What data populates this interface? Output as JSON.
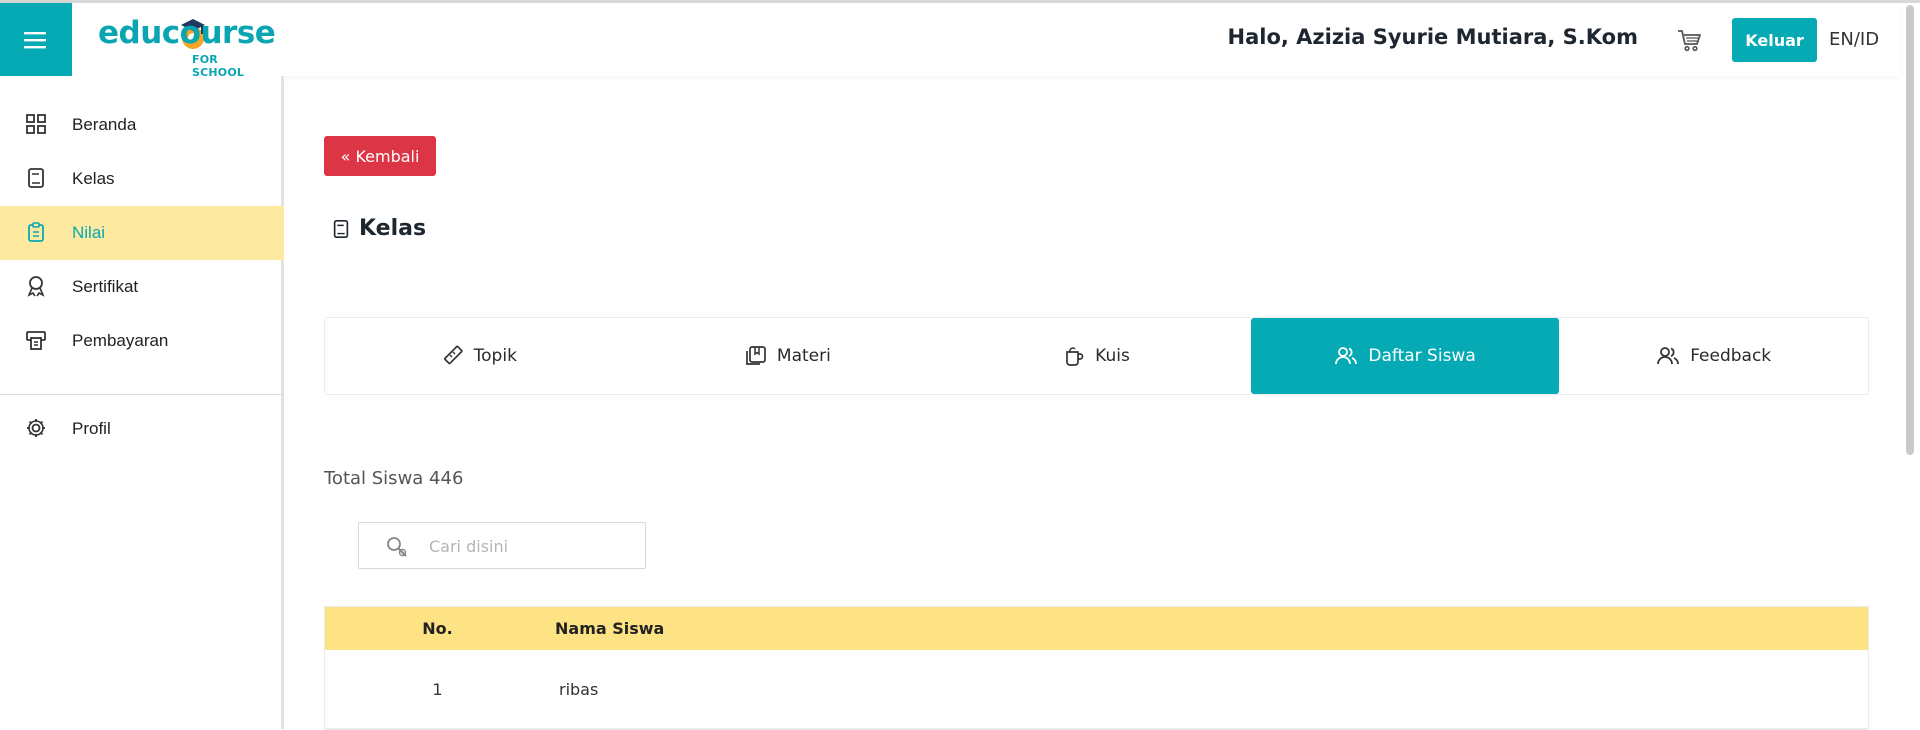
{
  "header": {
    "logo_text": "educourse",
    "logo_sub": "FOR SCHOOL",
    "greeting": "Halo, Azizia Syurie Mutiara, S.Kom",
    "logout_label": "Keluar",
    "lang_en": "EN",
    "lang_sep": "/",
    "lang_id": "ID"
  },
  "sidebar": {
    "items": [
      {
        "label": "Beranda",
        "icon": "grid-icon"
      },
      {
        "label": "Kelas",
        "icon": "book-icon"
      },
      {
        "label": "Nilai",
        "icon": "clipboard-icon",
        "active": true
      },
      {
        "label": "Sertifikat",
        "icon": "award-icon"
      },
      {
        "label": "Pembayaran",
        "icon": "payment-icon"
      }
    ],
    "profile": {
      "label": "Profil",
      "icon": "gear-icon"
    }
  },
  "main": {
    "back_label": "« Kembali",
    "title": "Kelas",
    "tabs": [
      {
        "label": "Topik",
        "icon": "ruler-icon"
      },
      {
        "label": "Materi",
        "icon": "materials-icon"
      },
      {
        "label": "Kuis",
        "icon": "mug-icon"
      },
      {
        "label": "Daftar Siswa",
        "icon": "users-icon",
        "active": true
      },
      {
        "label": "Feedback",
        "icon": "users-icon"
      }
    ],
    "total": "Total Siswa 446",
    "search_placeholder": "Cari disini",
    "table": {
      "headers": [
        "No.",
        "Nama Siswa"
      ],
      "rows": [
        [
          "1",
          "ribas"
        ]
      ]
    }
  },
  "colors": {
    "accent": "#05aab4",
    "active_bg": "#fde9a0",
    "table_head": "#fde384",
    "danger": "#dc3545"
  }
}
